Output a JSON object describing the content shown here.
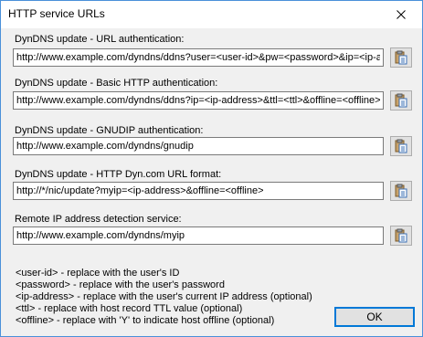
{
  "window": {
    "title": "HTTP service URLs"
  },
  "sections": [
    {
      "label": "DynDNS update - URL authentication:",
      "value": "http://www.example.com/dyndns/ddns?user=<user-id>&pw=<password>&ip=<ip-address>&ttl=<ttl>&offline=<offline>"
    },
    {
      "label": "DynDNS update - Basic HTTP authentication:",
      "value": "http://www.example.com/dyndns/ddns?ip=<ip-address>&ttl=<ttl>&offline=<offline>"
    },
    {
      "label": "DynDNS update - GNUDIP authentication:",
      "value": "http://www.example.com/dyndns/gnudip"
    },
    {
      "label": "DynDNS update - HTTP Dyn.com URL format:",
      "value": "http://*/nic/update?myip=<ip-address>&offline=<offline>"
    },
    {
      "label": "Remote IP address detection service:",
      "value": "http://www.example.com/dyndns/myip"
    }
  ],
  "legend": [
    "<user-id> - replace with the user's ID",
    "<password> - replace with the user's password",
    "<ip-address> - replace with the user's current IP address (optional)",
    "<ttl> - replace with host record TTL value (optional)",
    "<offline> - replace with 'Y' to indicate host offline (optional)"
  ],
  "buttons": {
    "ok": "OK"
  },
  "icons": {
    "close": "close-icon",
    "copy": "paste-clipboard-icon"
  },
  "colors": {
    "accent": "#0078d7",
    "window_border": "#4a90d9"
  }
}
